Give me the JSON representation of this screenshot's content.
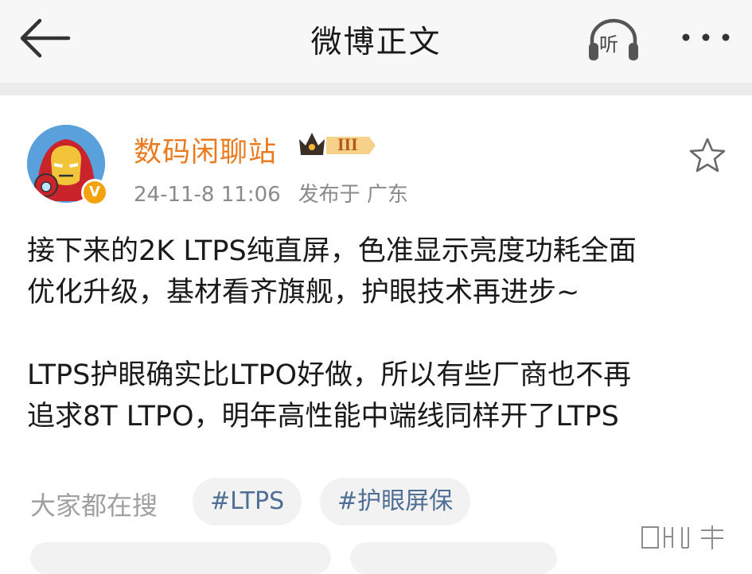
{
  "header": {
    "title": "微博正文",
    "listen_label": "听"
  },
  "post": {
    "author": "数码闲聊站",
    "member_badge": "III",
    "verified_badge": "V",
    "timestamp": "24-11-8 11:06",
    "location": "发布于 广东",
    "lines": [
      "接下来的2K LTPS纯直屏，色准显示亮度功耗全面",
      "优化升级，基材看齐旗舰，护眼技术再进步~",
      "LTPS护眼确实比LTPO好做，所以有些厂商也不再",
      "追求8T LTPO，明年高性能中端线同样开了LTPS"
    ]
  },
  "search": {
    "label": "大家都在搜",
    "tags": [
      "#LTPS",
      "#护眼屏保"
    ]
  },
  "colors": {
    "username": "#eb7a1e",
    "tag_text": "#4e6e96",
    "meta_text": "#8a8a8a",
    "header_bg": "#f7f7f7"
  },
  "icons": {
    "back": "back-arrow-icon",
    "listen": "headphones-icon",
    "more": "more-dots-icon",
    "favorite": "star-icon",
    "avatar": "ironman-avatar"
  }
}
